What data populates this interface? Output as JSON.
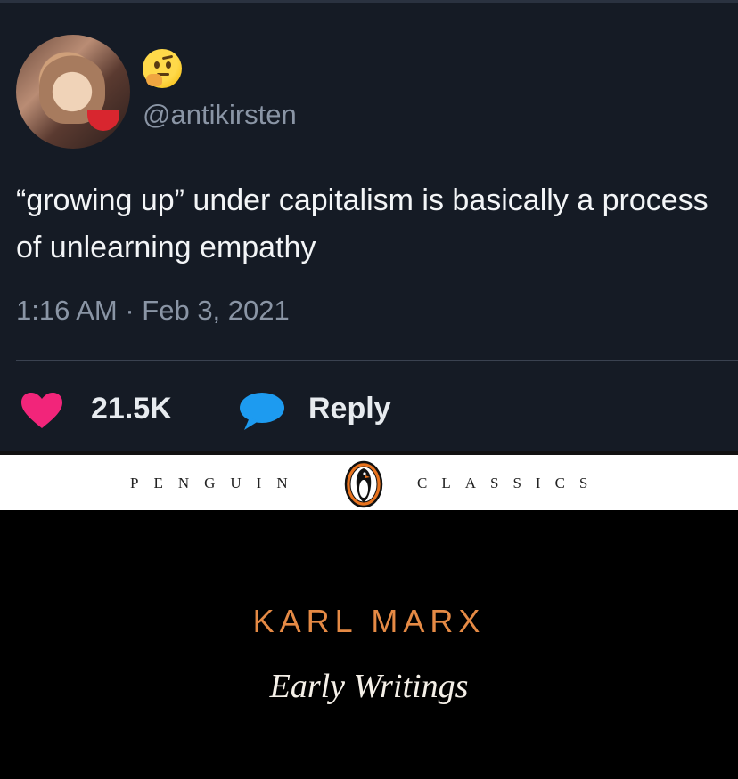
{
  "tweet": {
    "handle": "@antikirsten",
    "text": "“growing up” under capitalism is basically a process of unlearning empathy",
    "timestamp": "1:16 AM · Feb 3, 2021",
    "likes": "21.5K",
    "reply_label": "Reply",
    "icons": {
      "avatar": "profile-photo",
      "emoji": "thinking-face-emoji",
      "like": "heart-icon",
      "reply": "speech-bubble-icon"
    },
    "colors": {
      "background": "#151b25",
      "heart": "#f2257a",
      "bubble": "#1d9bf0"
    }
  },
  "book": {
    "band_left": "PENGUIN",
    "band_right": "CLASSICS",
    "author": "KARL MARX",
    "title": "Early Writings",
    "colors": {
      "author": "#e58a45",
      "logo": "#e8731f"
    }
  }
}
